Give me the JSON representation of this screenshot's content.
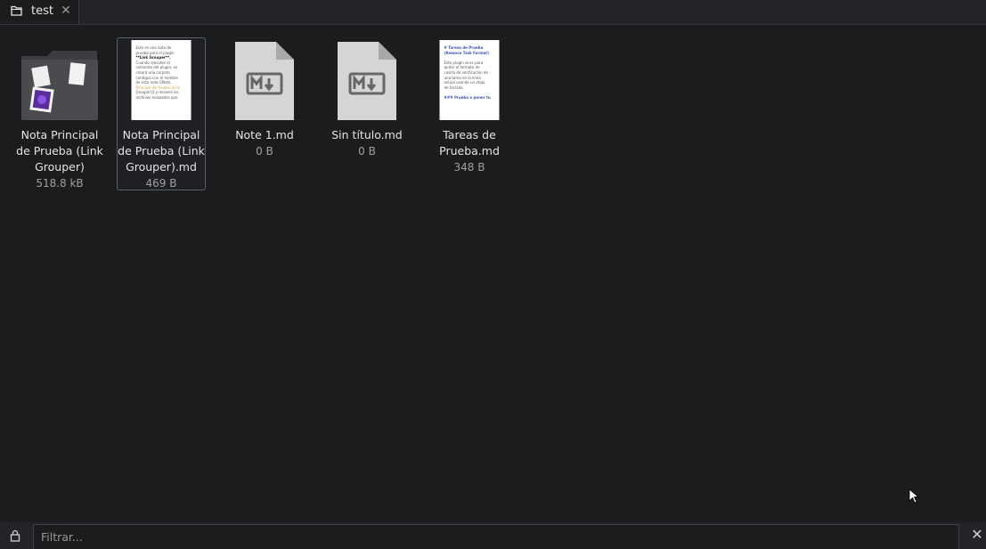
{
  "tab": {
    "label": "test",
    "icon": "folder-icon",
    "close_icon": "close-icon",
    "close_glyph": "✕"
  },
  "items": [
    {
      "name": "Nota Principal de Prueba (Link Grouper)",
      "size": "518.8 kB",
      "icon": "folder-icon",
      "selected": false
    },
    {
      "name": "Nota Principal de Prueba (Link Grouper).md",
      "size": "469 B",
      "icon": "document-preview",
      "selected": true,
      "preview": [
        "Este es una nota de",
        "prueba para el plugin",
        "**Link Grouper**.",
        "Cuando ejecutes el",
        "comando del plugin, se",
        "creará una carpeta",
        "contigua con el nombre",
        "de esta nota ([Nota",
        "Principal de Prueba (Link",
        "Grouper)]) y moverá los",
        "archivos enlazados que"
      ]
    },
    {
      "name": "Note 1.md",
      "size": "0 B",
      "icon": "markdown-file-icon",
      "selected": false
    },
    {
      "name": "Sin título.md",
      "size": "0 B",
      "icon": "markdown-file-icon",
      "selected": false
    },
    {
      "name": "Tareas de Prueba.md",
      "size": "348 B",
      "icon": "document-preview",
      "selected": false,
      "preview": [
        "# Tareas de Prueba",
        "(Remove Task Format)",
        "",
        "Este plugin sirve para",
        "quitar el formato de",
        "casilla de verificación de",
        "una tarea en la línea",
        "actual usando un atajo",
        "de teclado.",
        "",
        "### Prueba a poner tu"
      ]
    }
  ],
  "filter": {
    "placeholder": "Filtrar..."
  },
  "bottom": {
    "lock_icon": "lock-icon",
    "clear_glyph": "✕"
  }
}
